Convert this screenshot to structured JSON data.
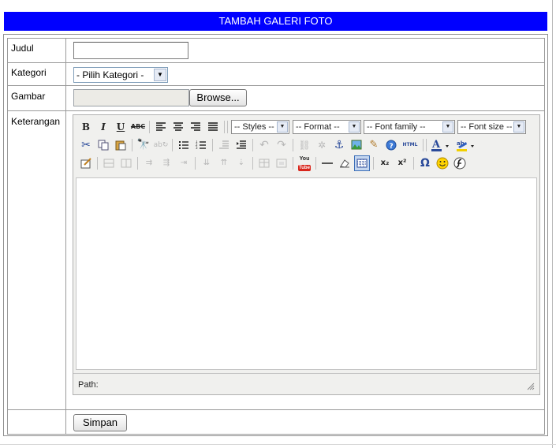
{
  "header": {
    "title": "TAMBAH GALERI FOTO"
  },
  "form": {
    "judul": {
      "label": "Judul",
      "value": ""
    },
    "kategori": {
      "label": "Kategori",
      "selected": "- Pilih Kategori -"
    },
    "gambar": {
      "label": "Gambar",
      "browse_label": "Browse..."
    },
    "keterangan": {
      "label": "Keterangan"
    },
    "submit_label": "Simpan"
  },
  "editor": {
    "styles_select": "-- Styles --",
    "format_select": "-- Format --",
    "font_family_select": "-- Font family --",
    "font_size_select": "-- Font size --",
    "path_label": "Path:",
    "toolbar1": [
      "bold",
      "italic",
      "underline",
      "strikethrough",
      "justify-left",
      "justify-center",
      "justify-right",
      "justify-full"
    ],
    "toolbar2": [
      "cut",
      "copy",
      "paste",
      "find",
      "replace",
      "bullet-list",
      "numbered-list",
      "outdent",
      "indent",
      "undo",
      "redo",
      "link",
      "unlink",
      "anchor",
      "image",
      "cleanup",
      "help",
      "html",
      "text-color",
      "highlight-color"
    ],
    "toolbar3": [
      "edit-box",
      "insert-layer",
      "insert-layer2",
      "insert-row-before",
      "insert-row-after",
      "delete-row",
      "insert-col-before",
      "insert-col-after",
      "delete-col",
      "table-props",
      "cell-props",
      "youtube",
      "horizontal-rule",
      "remove-format",
      "visual-aid",
      "subscript",
      "superscript",
      "special-char",
      "emotions",
      "flash"
    ],
    "glyphs": {
      "bold": "B",
      "italic": "I",
      "underline": "U",
      "strikethrough": "ABC",
      "cut": "✂",
      "subscript": "x₂",
      "superscript": "x²",
      "special-char": "Ω",
      "html": "HTML",
      "youtube_top": "You",
      "youtube_bottom": "Tube"
    },
    "colors": {
      "text": "#2a4a9a",
      "highlight": "#f2d000"
    }
  }
}
